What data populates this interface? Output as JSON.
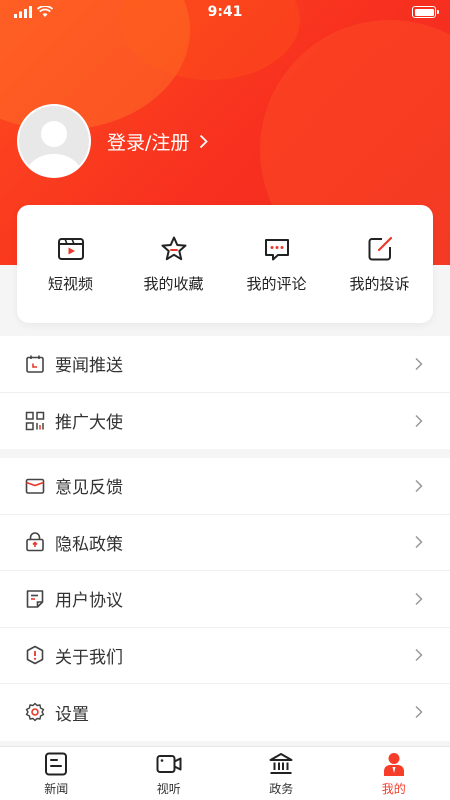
{
  "status_bar": {
    "time": "9:41"
  },
  "profile": {
    "login_label": "登录/注册",
    "chevron": "›"
  },
  "quick_actions": [
    {
      "label": "短视频",
      "icon": "video-icon"
    },
    {
      "label": "我的收藏",
      "icon": "star-icon"
    },
    {
      "label": "我的评论",
      "icon": "comment-icon"
    },
    {
      "label": "我的投诉",
      "icon": "complaint-icon"
    }
  ],
  "menu_group_1": [
    {
      "label": "要闻推送",
      "icon": "calendar-icon"
    },
    {
      "label": "推广大使",
      "icon": "qr-code-icon"
    }
  ],
  "menu_group_2": [
    {
      "label": "意见反馈",
      "icon": "envelope-icon"
    },
    {
      "label": "隐私政策",
      "icon": "lock-icon"
    },
    {
      "label": "用户协议",
      "icon": "document-icon"
    },
    {
      "label": "关于我们",
      "icon": "info-shield-icon"
    },
    {
      "label": "设置",
      "icon": "gear-icon"
    }
  ],
  "tabbar": [
    {
      "label": "新闻",
      "icon": "news-icon",
      "active": false
    },
    {
      "label": "视听",
      "icon": "camera-icon",
      "active": false
    },
    {
      "label": "政务",
      "icon": "government-icon",
      "active": false
    },
    {
      "label": "我的",
      "icon": "user-icon",
      "active": true
    }
  ],
  "colors": {
    "accent": "#f53d2a",
    "header_start": "#ff4b1f",
    "header_end": "#ef2a22",
    "icon_red": "#e8392b"
  }
}
